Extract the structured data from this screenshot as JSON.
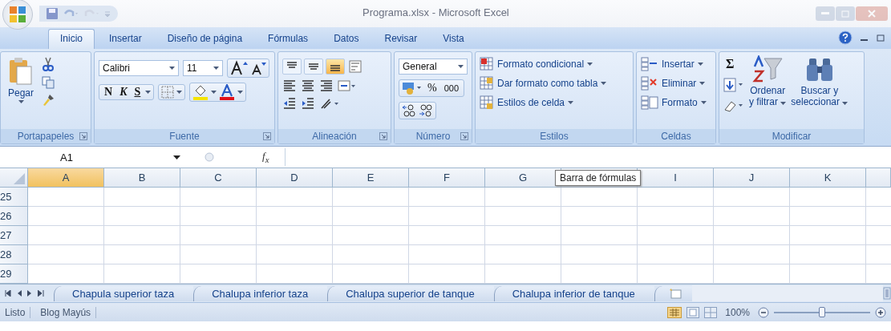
{
  "window": {
    "title": "Programa.xlsx - Microsoft Excel"
  },
  "tabs": [
    {
      "label": "Inicio",
      "selected": true
    },
    {
      "label": "Insertar",
      "selected": false
    },
    {
      "label": "Diseño de página",
      "selected": false
    },
    {
      "label": "Fórmulas",
      "selected": false
    },
    {
      "label": "Datos",
      "selected": false
    },
    {
      "label": "Revisar",
      "selected": false
    },
    {
      "label": "Vista",
      "selected": false
    }
  ],
  "ribbon": {
    "groups": [
      {
        "kind": "clipboard",
        "label": "Portapapeles",
        "paste": "Pegar"
      },
      {
        "kind": "font",
        "label": "Fuente",
        "font": "Calibri",
        "size": "11",
        "bold": "N",
        "italic": "K",
        "underline": "S"
      },
      {
        "kind": "alignment",
        "label": "Alineación",
        "vertical_align": [
          {
            "selected": false
          },
          {
            "selected": false
          },
          {
            "selected": true
          }
        ]
      },
      {
        "kind": "number",
        "label": "Número",
        "format": "General",
        "percent": "%",
        "thousands": "000"
      },
      {
        "kind": "styles",
        "label": "Estilos",
        "items": [
          "Formato condicional",
          "Dar formato como tabla",
          "Estilos de celda"
        ]
      },
      {
        "kind": "cells",
        "label": "Celdas",
        "items": [
          "Insertar",
          "Eliminar",
          "Formato"
        ]
      },
      {
        "kind": "editing",
        "label": "Modificar",
        "sum": "Σ",
        "sort": [
          "Ordenar",
          "y filtrar"
        ],
        "find": [
          "Buscar y",
          "seleccionar"
        ]
      }
    ]
  },
  "formula_bar": {
    "name_box": "A1",
    "fx": "f$_{x}$",
    "tooltip": "Barra de fórmulas"
  },
  "sheet": {
    "columns": [
      {
        "label": "A",
        "selected": true
      },
      {
        "label": "B",
        "selected": false
      },
      {
        "label": "C",
        "selected": false
      },
      {
        "label": "D",
        "selected": false
      },
      {
        "label": "E",
        "selected": false
      },
      {
        "label": "F",
        "selected": false
      },
      {
        "label": "G",
        "selected": false
      },
      {
        "selected": false
      },
      {
        "label": "I",
        "selected": false
      },
      {
        "label": "J",
        "selected": false
      },
      {
        "label": "K",
        "selected": false
      }
    ],
    "rows": [
      "25",
      "26",
      "27",
      "28",
      "29"
    ]
  },
  "sheet_tabs": [
    {
      "label": "Chapula superior taza",
      "selected": false
    },
    {
      "label": "Chalupa inferior taza",
      "selected": false
    },
    {
      "label": "Chalupa superior de tanque",
      "selected": false
    },
    {
      "label": "Chalupa inferior de tanque",
      "selected": false
    }
  ],
  "status_bar": {
    "items": [
      "Listo",
      "Blog Mayús"
    ],
    "zoom": "100%",
    "level": 0.5
  }
}
